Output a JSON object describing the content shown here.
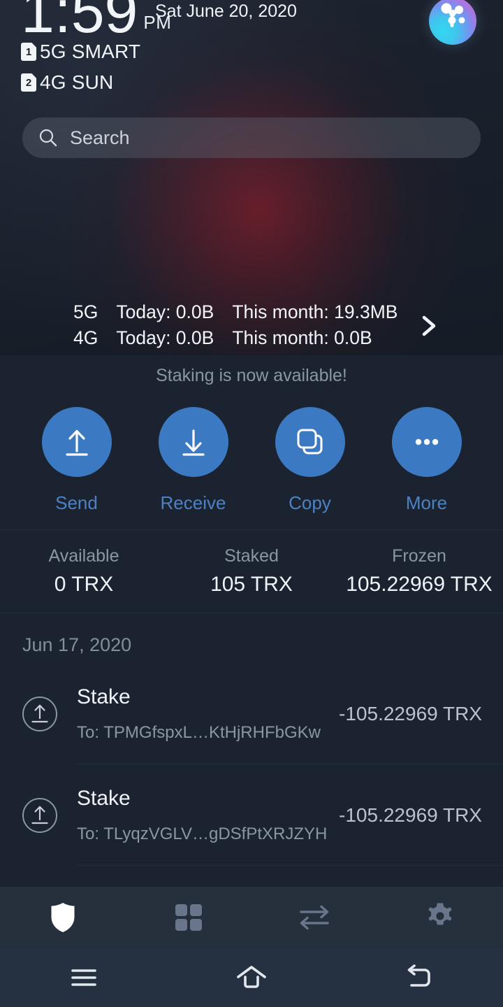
{
  "statusbar": {
    "time": "1:59",
    "ampm": "PM",
    "date": "Sat June 20, 2020",
    "avatar_icon": "gradient-orb-avatar-icon",
    "sims": [
      {
        "badge": "1",
        "label": "5G SMART"
      },
      {
        "badge": "2",
        "label": "4G SUN"
      }
    ]
  },
  "search": {
    "icon": "search-icon",
    "placeholder": "Search",
    "value": ""
  },
  "data_usage": {
    "rows": [
      {
        "network": "5G",
        "today": "Today: 0.0B",
        "month": "This month: 19.3MB"
      },
      {
        "network": "4G",
        "today": "Today: 0.0B",
        "month": "This month: 0.0B"
      }
    ],
    "chevron_icon": "chevron-right-icon"
  },
  "app": {
    "banner": "Staking is now available!",
    "actions": [
      {
        "label": "Send",
        "icon": "upload-arrow-icon"
      },
      {
        "label": "Receive",
        "icon": "download-arrow-icon"
      },
      {
        "label": "Copy",
        "icon": "copy-icon"
      },
      {
        "label": "More",
        "icon": "ellipsis-icon"
      }
    ],
    "balances": [
      {
        "label": "Available",
        "value": "0 TRX"
      },
      {
        "label": "Staked",
        "value": "105 TRX"
      },
      {
        "label": "Frozen",
        "value": "105.22969 TRX"
      }
    ],
    "transactions_date": "Jun 17, 2020",
    "transactions": [
      {
        "icon": "outbound-arrow-circle-icon",
        "title": "Stake",
        "subtitle": "To: TPMGfspxL…KtHjRHFbGKw",
        "amount": "-105.22969 TRX"
      },
      {
        "icon": "outbound-arrow-circle-icon",
        "title": "Stake",
        "subtitle": "To: TLyqzVGLV…gDSfPtXRJZYH",
        "amount": "-105.22969 TRX"
      }
    ]
  },
  "tabbar": {
    "items": [
      {
        "name": "wallet",
        "icon": "shield-icon",
        "active": true
      },
      {
        "name": "apps",
        "icon": "grid-icon",
        "active": false
      },
      {
        "name": "transfers",
        "icon": "swap-arrows-icon",
        "active": false
      },
      {
        "name": "settings",
        "icon": "gear-icon",
        "active": false
      }
    ]
  },
  "navbar": {
    "items": [
      {
        "name": "recents",
        "icon": "menu-icon"
      },
      {
        "name": "home",
        "icon": "home-icon"
      },
      {
        "name": "back",
        "icon": "back-arrow-icon"
      }
    ]
  },
  "colors": {
    "accent_blue": "#3b7ac2",
    "label_blue": "#4c82c4",
    "app_bg": "#1b2330",
    "tabbar_bg": "#26303d",
    "navbar_bg": "#253040",
    "muted_text": "#8c95a3",
    "primary_text": "#f0f3f7"
  }
}
